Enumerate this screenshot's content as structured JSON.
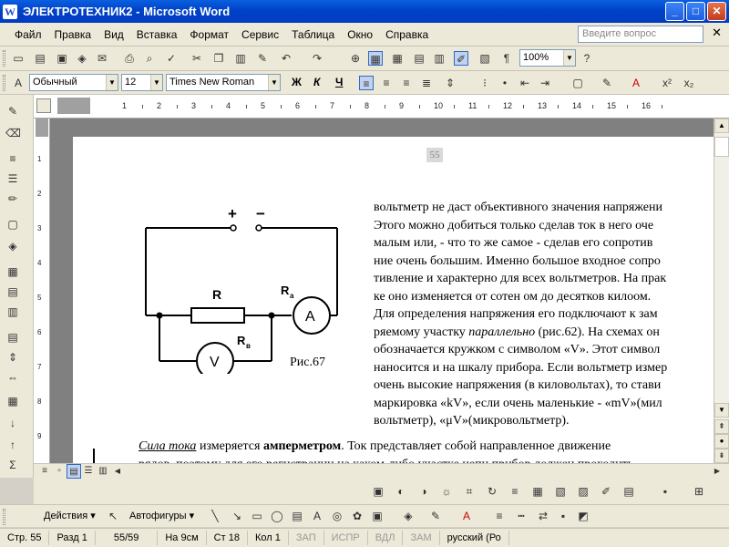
{
  "window": {
    "title": "ЭЛЕКТРОТЕХНИК2 - Microsoft Word"
  },
  "menu": [
    "Файл",
    "Правка",
    "Вид",
    "Вставка",
    "Формат",
    "Сервис",
    "Таблица",
    "Окно",
    "Справка"
  ],
  "help_placeholder": "Введите вопрос",
  "toolbar": {
    "zoom": "100%",
    "style": "Обычный",
    "font_size": "12",
    "font": "Times New Roman",
    "bold": "Ж",
    "italic": "К",
    "underline": "Ч"
  },
  "ruler_numbers": [
    "1",
    "2",
    "3",
    "4",
    "5",
    "6",
    "7",
    "8",
    "9",
    "10",
    "11",
    "12",
    "13",
    "14",
    "15",
    "16"
  ],
  "page": {
    "number": "55"
  },
  "figure": {
    "plus": "+",
    "minus": "−",
    "label_r": "R",
    "label_ra": "R",
    "label_ra_sub": "a",
    "label_rv": "R",
    "label_rv_sub": "в",
    "ammeter": "A",
    "voltmeter": "V",
    "caption": "Рис.67"
  },
  "text_right": [
    "вольтметр не даст  объективного значения  напряжени",
    "Этого  можно  добиться  только  сделав ток в него оче",
    "малым или, -   что то же  самое  -  сделав  его сопротив",
    "ние  очень  большим. Именно большое  входное сопро",
    "тивление  и характерно для всех  вольтметров. На прак",
    "ке  оно  изменяется от сотен  ом до  десятков  килоом.",
    "Для  определения  напряжения  его подключают  к зам",
    "ряемому участку  ",
    "обозначается  кружком  с символом «V».  Этот символ",
    "наносится  и на шкалу прибора. Если вольтметр  измер",
    "очень  высокие  напряжения (в  киловольтах), то стави",
    "маркировка «kV», если очень маленькие  -  «mV»(мил",
    "вольтметр), «μV»(микровольтметр)."
  ],
  "text_line8_italic": "параллельно",
  "text_line8_rest": " (рис.62). На схемах  он",
  "para_bottom": {
    "term": "Сила  тока",
    "middle": "  измеряется  ",
    "bold": "амперметром",
    "rest": ". Ток представляет собой направленное движение",
    "line2": "рядов, поэтому для  его  регистрации на каком-либо  участке  цепи  прибор должен  проходить"
  },
  "drawing_toolbar": {
    "actions": "Действия ▾",
    "autoshapes": "Автофигуры ▾"
  },
  "status": {
    "page": "Стр.  55",
    "section": "Разд  1",
    "count": "55/59",
    "at": "На  9см",
    "line": "Ст  18",
    "col": "Кол  1",
    "rec": "ЗАП",
    "trk": "ИСПР",
    "ext": "ВДЛ",
    "ovr": "ЗАМ",
    "lang": "русский (Ро"
  }
}
